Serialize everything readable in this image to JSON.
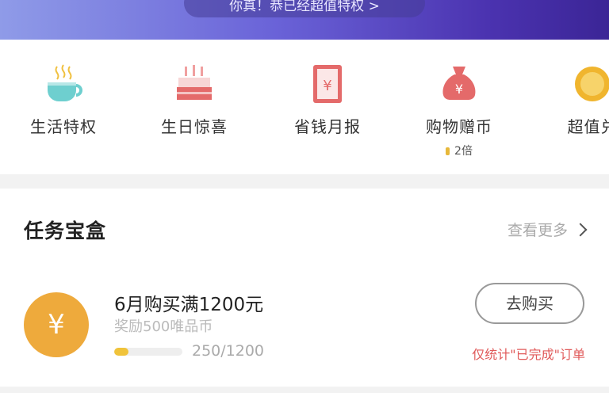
{
  "banner": {
    "text": "你真！恭已经超值特权 >"
  },
  "privileges": [
    {
      "label": "生活特权",
      "icon": "coffee-cup-icon",
      "color": "#6ecfcf"
    },
    {
      "label": "生日惊喜",
      "icon": "birthday-cake-icon",
      "color": "#e46a6a"
    },
    {
      "label": "省钱月报",
      "icon": "money-report-icon",
      "color": "#e46a6a"
    },
    {
      "label": "购物赠币",
      "icon": "money-bag-icon",
      "color": "#e46a6a",
      "sub": "2倍"
    },
    {
      "label": "超值兑",
      "icon": "gold-coin-icon",
      "color": "#f0b52e"
    }
  ],
  "task_box": {
    "title": "任务宝盒",
    "more_label": "查看更多",
    "task": {
      "coin_symbol": "¥",
      "name": "6月购买满1200元",
      "reward": "奖励500唯品币",
      "progress_text": "250/1200",
      "progress_fraction": 0.208,
      "button_label": "去购买",
      "note": "仅统计\"已完成\"订单"
    }
  },
  "colors": {
    "accent_coin": "#eeaa3c",
    "progress_fill": "#f0c33a",
    "note_red": "#e05a5a"
  }
}
